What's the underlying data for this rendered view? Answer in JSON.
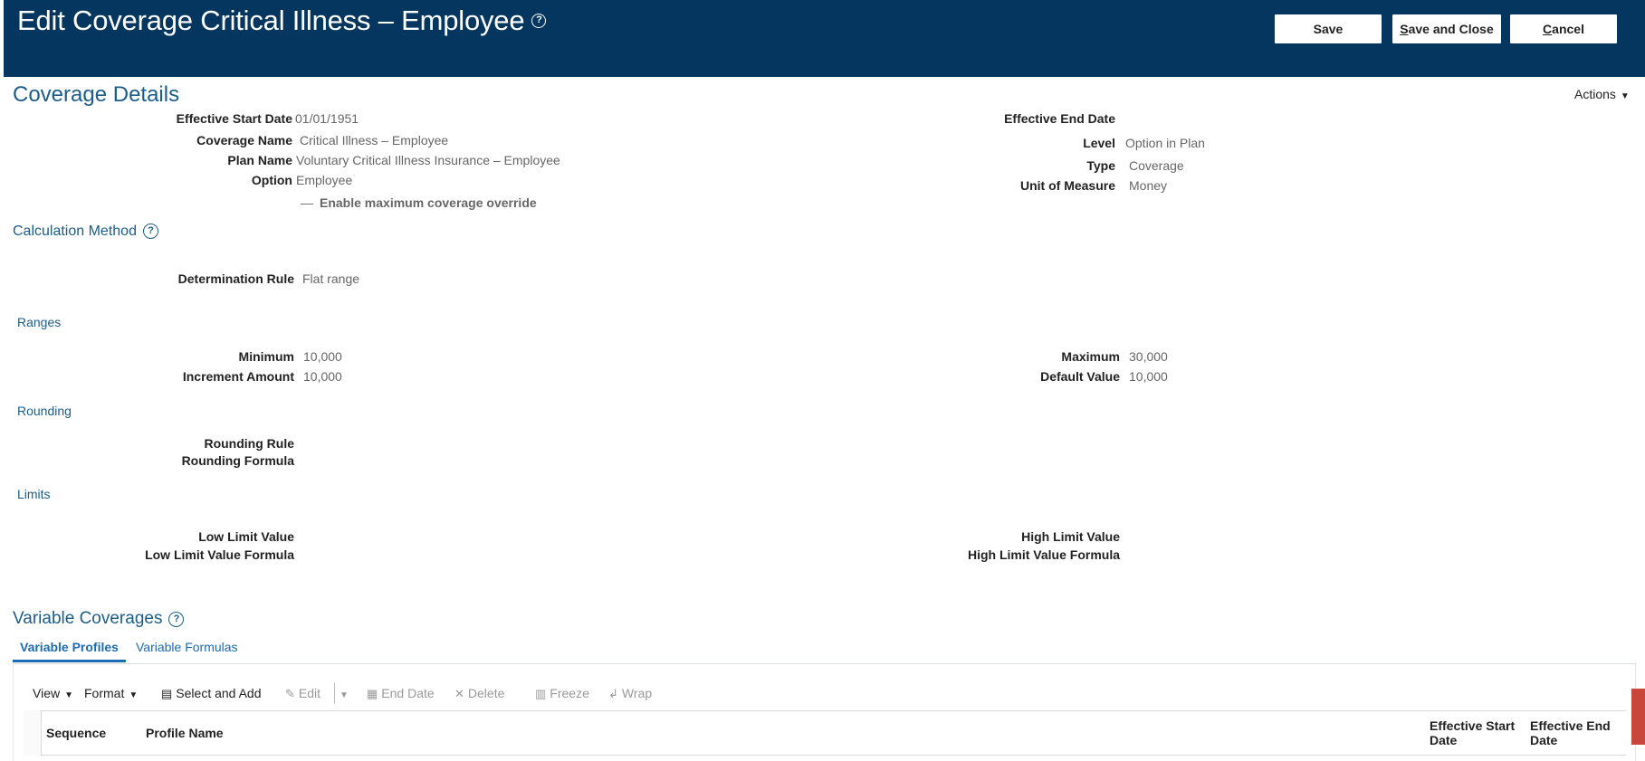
{
  "header": {
    "title": "Edit Coverage Critical Illness – Employee",
    "buttons": {
      "save": "Save",
      "save_and_close_first": "S",
      "save_and_close_rest": "ave and Close",
      "cancel_first": "C",
      "cancel_rest": "ancel"
    }
  },
  "coverage_details": {
    "title": "Coverage Details",
    "actions_label": "Actions",
    "effective_start_date_label": "Effective Start Date",
    "effective_start_date": "01/01/1951",
    "coverage_name_label": "Coverage Name",
    "coverage_name": "Critical Illness – Employee",
    "plan_name_label": "Plan Name",
    "plan_name": "Voluntary Critical Illness Insurance – Employee",
    "option_label": "Option",
    "option": "Employee",
    "enable_override_label": "Enable maximum coverage override",
    "effective_end_date_label": "Effective End Date",
    "effective_end_date": "",
    "level_label": "Level",
    "level": "Option in Plan",
    "type_label": "Type",
    "type": "Coverage",
    "unit_of_measure_label": "Unit of Measure",
    "unit_of_measure": "Money"
  },
  "calculation_method": {
    "title": "Calculation Method",
    "determination_rule_label": "Determination Rule",
    "determination_rule": "Flat range"
  },
  "ranges": {
    "title": "Ranges",
    "minimum_label": "Minimum",
    "minimum": "10,000",
    "increment_amount_label": "Increment Amount",
    "increment_amount": "10,000",
    "maximum_label": "Maximum",
    "maximum": "30,000",
    "default_value_label": "Default Value",
    "default_value": "10,000"
  },
  "rounding": {
    "title": "Rounding",
    "rounding_rule_label": "Rounding Rule",
    "rounding_formula_label": "Rounding Formula"
  },
  "limits": {
    "title": "Limits",
    "low_limit_value_label": "Low Limit Value",
    "low_limit_value_formula_label": "Low Limit Value Formula",
    "high_limit_value_label": "High Limit Value",
    "high_limit_value_formula_label": "High Limit Value Formula"
  },
  "variable_coverages": {
    "title": "Variable Coverages",
    "tabs": [
      {
        "label": "Variable Profiles",
        "active": true
      },
      {
        "label": "Variable Formulas",
        "active": false
      }
    ],
    "toolbar": {
      "view": "View",
      "format": "Format",
      "select_and_add": "Select and Add",
      "edit": "Edit",
      "end_date": "End Date",
      "delete": "Delete",
      "freeze": "Freeze",
      "wrap": "Wrap"
    },
    "columns": {
      "sequence": "Sequence",
      "profile_name": "Profile Name",
      "effective_start_date_1": "Effective Start",
      "effective_start_date_2": "Date",
      "effective_end_date_1": "Effective End",
      "effective_end_date_2": "Date"
    }
  },
  "colors": {
    "header_bg": "#04365f",
    "section_blue": "#1b5d8b",
    "tab_blue": "#1b6bb5",
    "side_tab_red": "#c9473a"
  }
}
